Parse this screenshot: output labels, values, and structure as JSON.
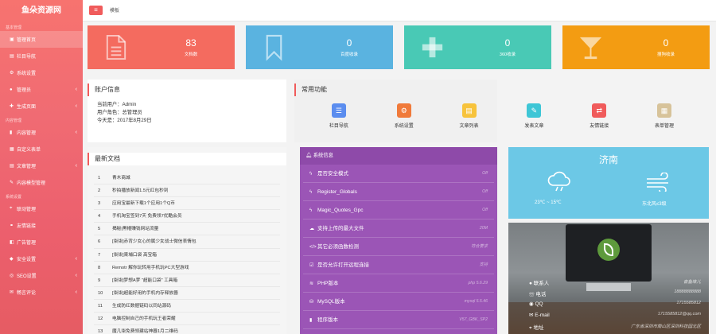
{
  "sidebar": {
    "logo": "鱼朵资源网",
    "sections": [
      {
        "title": "基本管理",
        "items": [
          {
            "label": "管理首页",
            "icon": "home-icon",
            "active": true
          },
          {
            "label": "栏目导航",
            "icon": "list-icon"
          },
          {
            "label": "系统设置",
            "icon": "gear-icon"
          },
          {
            "label": "管理员",
            "icon": "user-icon",
            "expand": true
          },
          {
            "label": "生成页面",
            "icon": "file-icon",
            "expand": true
          }
        ]
      },
      {
        "title": "内容管理",
        "items": [
          {
            "label": "内容管理",
            "icon": "doc-icon",
            "expand": true
          },
          {
            "label": "自定义表单",
            "icon": "form-icon"
          },
          {
            "label": "文章管理",
            "icon": "article-icon",
            "expand": true
          },
          {
            "label": "内容模型管理",
            "icon": "model-icon"
          }
        ]
      },
      {
        "title": "系统设置",
        "items": [
          {
            "label": "联动管理",
            "icon": "link-icon"
          },
          {
            "label": "友情链接",
            "icon": "chain-icon"
          },
          {
            "label": "广告管理",
            "icon": "ad-icon"
          },
          {
            "label": "安全设置",
            "icon": "shield-icon",
            "expand": true
          },
          {
            "label": "SEO设置",
            "icon": "seo-icon",
            "expand": true
          },
          {
            "label": "畅言评论",
            "icon": "comment-icon",
            "expand": true
          }
        ]
      }
    ]
  },
  "topbar": {
    "menu_icon": "≡",
    "breadcrumb": "模板"
  },
  "stats": [
    {
      "value": "83",
      "label": "文档数",
      "color": "#f46b5f",
      "icon": "document-icon"
    },
    {
      "value": "0",
      "label": "百度收录",
      "color": "#5ab3e0",
      "icon": "bookmark-icon"
    },
    {
      "value": "0",
      "label": "360收录",
      "color": "#49c9b5",
      "icon": "plus-icon"
    },
    {
      "value": "0",
      "label": "搜狗收录",
      "color": "#f39c12",
      "icon": "cocktail-icon"
    }
  ],
  "account": {
    "title": "账户信息",
    "lines": [
      "当前用户：Admin",
      "用户角色：总管理员",
      "今天是：2017年8月29日"
    ]
  },
  "functions": {
    "title": "常用功能",
    "items": [
      {
        "label": "栏目导航",
        "color": "#5b8def",
        "icon": "menu-icon",
        "glyph": "☰"
      },
      {
        "label": "系统设置",
        "color": "#f07a3a",
        "icon": "gear-icon",
        "glyph": "⚙"
      },
      {
        "label": "文章列表",
        "color": "#f7c33c",
        "icon": "file-icon",
        "glyph": "▤"
      },
      {
        "label": "发表文章",
        "color": "#3ec6d6",
        "icon": "brush-icon",
        "glyph": "✎"
      },
      {
        "label": "友情链接",
        "color": "#f05b5b",
        "icon": "link-icon",
        "glyph": "⇄"
      },
      {
        "label": "表单管理",
        "color": "#d7c39a",
        "icon": "form-icon",
        "glyph": "▦"
      }
    ]
  },
  "latest": {
    "title": "最新文档",
    "rows": [
      {
        "n": "1",
        "t": "青木商城"
      },
      {
        "n": "2",
        "t": "秒拍播放新闻1.5元红包秒到"
      },
      {
        "n": "3",
        "t": "应用宝最新下载1个应用1个Q币"
      },
      {
        "n": "4",
        "t": "手机淘宝签到7天 免费领7优酷会员"
      },
      {
        "n": "5",
        "t": "揭秘|黑帽赚钱网站流量"
      },
      {
        "n": "6",
        "t": "[柒柒]赤背少女心的属少女战士微信表情包"
      },
      {
        "n": "7",
        "t": "[柒柒]柬埔口袋 高宝箱"
      },
      {
        "n": "8",
        "t": "Remotr 解你玩转用手机玩PC大型游戏"
      },
      {
        "n": "9",
        "t": "[柒柒]梦想A梦 “超能口袋” 工具箱"
      },
      {
        "n": "10",
        "t": "[柒柒]超能好用的手机内存释放器"
      },
      {
        "n": "11",
        "t": "生成防红数据链码以同站源码"
      },
      {
        "n": "12",
        "t": "电脑控制自己的手机玩王者荣耀"
      },
      {
        "n": "13",
        "t": "魔几柒免费领建站神器1月二维码"
      }
    ]
  },
  "system": {
    "title": "系统信息",
    "rows": [
      {
        "label": "是否安全模式",
        "value": "Off",
        "icon": "lightning-icon",
        "glyph": "ϟ"
      },
      {
        "label": "Register_Globals",
        "value": "Off",
        "icon": "lightning-icon",
        "glyph": "ϟ"
      },
      {
        "label": "Magic_Quotes_Gpc",
        "value": "Off",
        "icon": "lightning-icon",
        "glyph": "ϟ"
      },
      {
        "label": "支持上传的最大文件",
        "value": "20M",
        "icon": "cloud-upload-icon",
        "glyph": "☁"
      },
      {
        "label": "其它必须函数检测",
        "value": "符合要求",
        "icon": "code-icon",
        "glyph": "</>"
      },
      {
        "label": "是否允许打开远程连接",
        "value": "支持",
        "icon": "checkbox-icon",
        "glyph": "☑"
      },
      {
        "label": "PHP版本",
        "value": "php 5.6.29",
        "icon": "stack-icon",
        "glyph": "≋"
      },
      {
        "label": "MySQL版本",
        "value": "mysql 5.5.46",
        "icon": "database-icon",
        "glyph": "⛁"
      },
      {
        "label": "程序版本",
        "value": "V57_GBK_SP2",
        "icon": "book-icon",
        "glyph": "▮"
      }
    ]
  },
  "weather": {
    "city": "济南",
    "temp": "23℃ ~ 15℃",
    "wind": "东北风≤3级"
  },
  "contacts": [
    {
      "label": "联系人",
      "value": "奋鱼味儿",
      "icon": "person-icon",
      "glyph": "●"
    },
    {
      "label": "电话",
      "value": "18888888888",
      "icon": "phone-icon",
      "glyph": "☏"
    },
    {
      "label": "QQ",
      "value": "1715585812",
      "icon": "qq-icon",
      "glyph": "◉"
    },
    {
      "label": "E-mail",
      "value": "1715585812@qq.com",
      "icon": "mail-icon",
      "glyph": "✉"
    },
    {
      "label": "地址",
      "value": "广东省深圳市南山区深圳科技园北区",
      "icon": "location-icon",
      "glyph": "⌖"
    }
  ]
}
